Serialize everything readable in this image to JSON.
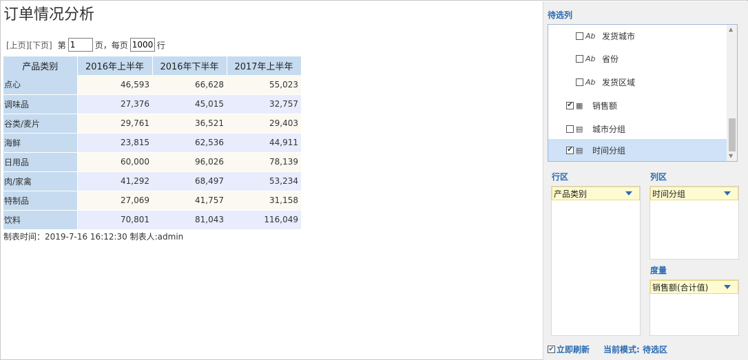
{
  "report": {
    "title": "订单情况分析",
    "pager": {
      "prev": "[上页]",
      "next": "[下页]",
      "page_prefix": "第",
      "page_value": "1",
      "page_suffix": "页，每页",
      "size_value": "1000",
      "size_suffix": "行"
    },
    "columns": [
      "产品类别",
      "2016年上半年",
      "2016年下半年",
      "2017年上半年"
    ],
    "rows": [
      [
        "点心",
        "46,593",
        "66,628",
        "55,023"
      ],
      [
        "调味品",
        "27,376",
        "45,015",
        "32,757"
      ],
      [
        "谷类/麦片",
        "29,761",
        "36,521",
        "29,403"
      ],
      [
        "海鲜",
        "23,815",
        "62,536",
        "44,911"
      ],
      [
        "日用品",
        "60,000",
        "96,026",
        "78,139"
      ],
      [
        "肉/家禽",
        "41,292",
        "68,497",
        "53,234"
      ],
      [
        "特制品",
        "27,069",
        "41,757",
        "31,158"
      ],
      [
        "饮料",
        "70,801",
        "81,043",
        "116,049"
      ]
    ],
    "footer": "制表时间：2019-7-16 16:12:30 制表人:admin"
  },
  "panel": {
    "candidates_label": "待选列",
    "fields": [
      {
        "label": "发货城市",
        "icon": "Ab",
        "checked": false
      },
      {
        "label": "省份",
        "icon": "Ab",
        "checked": false
      },
      {
        "label": "发货区域",
        "icon": "Ab",
        "checked": false
      },
      {
        "label": "销售额",
        "icon": "measure",
        "checked": true
      },
      {
        "label": "城市分组",
        "icon": "group",
        "checked": false
      },
      {
        "label": "时间分组",
        "icon": "group",
        "checked": true
      }
    ],
    "row_area_label": "行区",
    "row_area_value": "产品类别",
    "col_area_label": "列区",
    "col_area_value": "时间分组",
    "measure_label": "度量",
    "measure_value": "销售额(合计值)",
    "refresh_label": "立即刷新",
    "refresh_checked": true,
    "mode_label": "当前模式: 待选区"
  }
}
